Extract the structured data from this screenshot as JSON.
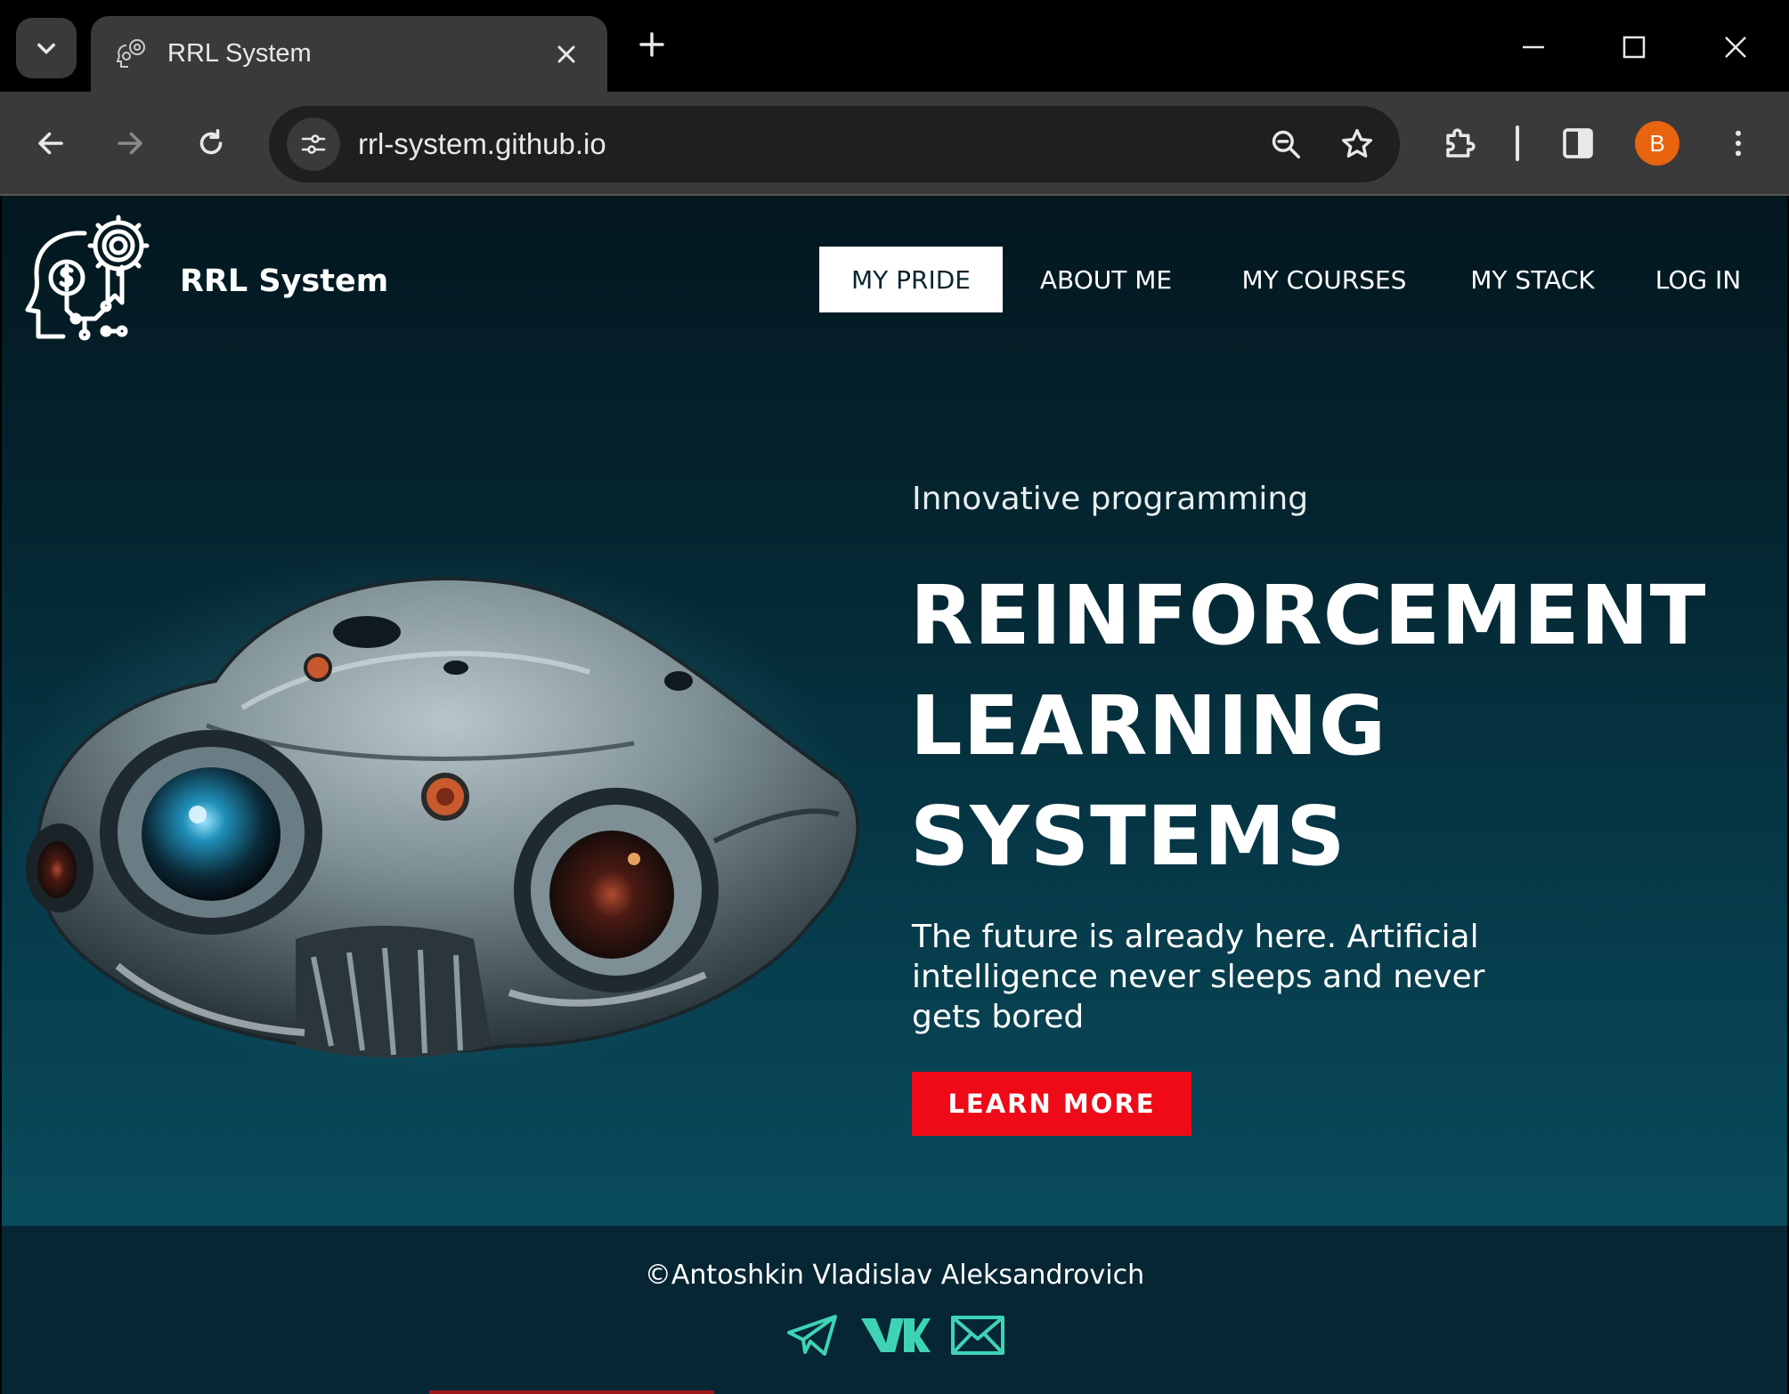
{
  "browser": {
    "tab_title": "RRL System",
    "url": "rrl-system.github.io",
    "profile_initial": "B",
    "profile_color": "#e8640f"
  },
  "site": {
    "brand": "RRL System",
    "nav": [
      {
        "label": "MY PRIDE",
        "active": true
      },
      {
        "label": "ABOUT ME",
        "active": false
      },
      {
        "label": "MY COURSES",
        "active": false
      },
      {
        "label": "MY STACK",
        "active": false
      },
      {
        "label": "LOG IN",
        "active": false
      }
    ]
  },
  "hero": {
    "eyebrow": "Innovative programming",
    "headline_lines": [
      "REINFORCEMENT",
      "LEARNING",
      "SYSTEMS"
    ],
    "lead": "The future is already here. Artificial intelligence never sleeps and never gets bored",
    "cta_label": "LEARN MORE",
    "cta_color": "#ee0a17"
  },
  "footer": {
    "copyright": "©Antoshkin Vladislav Aleksandrovich",
    "socials": [
      "telegram-icon",
      "vk-icon",
      "mail-icon"
    ],
    "social_color": "#3fd3b6"
  }
}
